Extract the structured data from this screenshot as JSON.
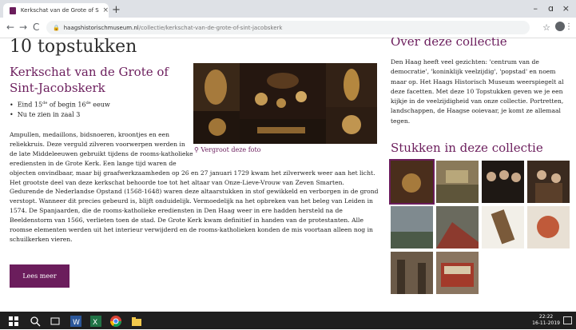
{
  "browser": {
    "tab_title": "Kerkschat van de Grote of Sint-Ja",
    "tab_close": "×",
    "new_tab": "+",
    "url_domain": "haagshistorischmuseum.nl",
    "url_path": "/collectie/kerkschat-van-de-grote-of-sint-jacobskerk",
    "window_controls": [
      "–",
      "ɑ",
      "×"
    ]
  },
  "page": {
    "title": "10 topstukken",
    "subtitle": "Kerkschat van de Grote of Sint-Jacobskerk",
    "facts": [
      {
        "pre": "Eind 15",
        "sup1": "de",
        "mid": " of begin 16",
        "sup2": "de",
        "post": " eeuw"
      },
      {
        "pre": "Nu te zien in zaal 3",
        "sup1": "",
        "mid": "",
        "sup2": "",
        "post": ""
      }
    ],
    "enlarge_link": "Vergroot deze foto",
    "body": "Ampullen, medaillons, bidsnoeren, kroontjes en een reliekkruis. Deze verguld zilveren voorwerpen werden in de late Middeleeuwen gebruikt tijdens de rooms-katholieke erediensten in de Grote Kerk. Een lange tijd waren de objecten onvindbaar, maar bij graafwerkzaamheden op 26 en 27 januari 1729 kwam het zilverwerk weer aan het licht. Het grootste deel van deze kerkschat behoorde toe tot het altaar van Onze-Lieve-Vrouw van Zeven Smarten. Gedurende de Nederlandse Opstand (1568-1648) waren deze altaarstukken in stof gewikkeld en verborgen in de grond verstopt. Wanneer dit precies gebeurd is, blijft onduidelijk. Vermoedelijk na het opbreken van het beleg van Leiden in 1574. De Spanjaarden, die de rooms-katholieke erediensten in Den Haag weer in ere hadden hersteld na de Beeldenstorm van 1566, verlieten toen de stad. De Grote Kerk kwam definitief in handen van de protestanten. Alle roomse elementen werden uit het interieur verwijderd en de rooms-katholieken konden de mis voortaan alleen nog in schuilkerken vieren.",
    "read_more": "Lees meer"
  },
  "sidebar": {
    "about_title": "Over deze collectie",
    "about_text": "Den Haag heeft veel gezichten: 'centrum van de democratie', 'koninklijk veelzijdig', 'popstad' en noem maar op. Het Haags Historisch Museum weerspiegelt al deze facetten. Met deze 10 Topstukken geven we je een kijkje in de veelzijdigheid van onze collectie. Portretten, landschappen, de Haagse ooievaar, je komt ze allemaal tegen.",
    "pieces_title": "Stukken in deze collectie"
  },
  "taskbar": {
    "time": "22:22",
    "date": "16-11-2019"
  },
  "colors": {
    "accent": "#6b1d5c"
  }
}
